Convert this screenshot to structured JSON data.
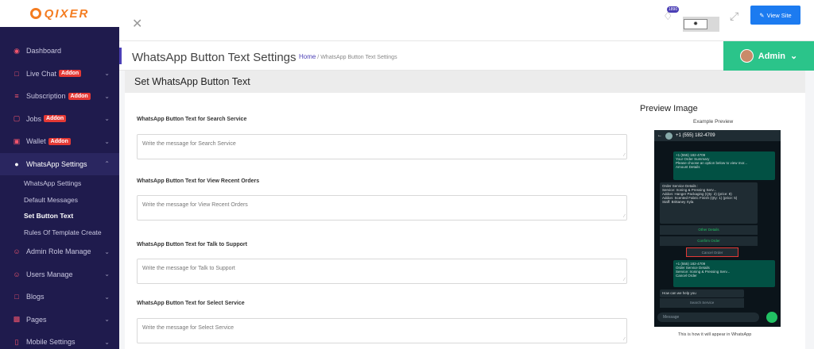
{
  "brand": {
    "name": "QIXER"
  },
  "sidebar": {
    "items": [
      {
        "label": "Dashboard",
        "icon": "palette-icon",
        "has_chevron": false
      },
      {
        "label": "Live Chat",
        "badge": "Addon",
        "icon": "chat-icon",
        "has_chevron": true
      },
      {
        "label": "Subscription",
        "badge": "Addon",
        "icon": "list-icon",
        "has_chevron": true
      },
      {
        "label": "Jobs",
        "badge": "Addon",
        "icon": "briefcase-icon",
        "has_chevron": true
      },
      {
        "label": "Wallet",
        "badge": "Addon",
        "icon": "wallet-icon",
        "has_chevron": true
      },
      {
        "label": "WhatsApp Settings",
        "icon": "whatsapp-icon",
        "has_chevron": true,
        "active": true
      }
    ],
    "sub_items": [
      {
        "label": "WhatsApp Settings"
      },
      {
        "label": "Default Messages"
      },
      {
        "label": "Set Button Text",
        "current": true
      },
      {
        "label": "Rules Of Template Create"
      }
    ],
    "items_after": [
      {
        "label": "Admin Role Manage",
        "icon": "user-icon"
      },
      {
        "label": "Users Manage",
        "icon": "user-icon"
      },
      {
        "label": "Blogs",
        "icon": "chat-icon"
      },
      {
        "label": "Pages",
        "icon": "pages-icon"
      },
      {
        "label": "Mobile Settings",
        "icon": "mobile-icon"
      }
    ]
  },
  "topbar": {
    "notification_count": "1890",
    "view_site_label": "View Site"
  },
  "header": {
    "title": "WhatsApp Button Text Settings",
    "breadcrumb_home": "Home",
    "breadcrumb_sep": "/",
    "breadcrumb_current": "WhatsApp Button Text Settings",
    "user_label": "Admin"
  },
  "section": {
    "title": "Set WhatsApp Button Text"
  },
  "form": {
    "fields": [
      {
        "label": "WhatsApp Button Text for Search Service",
        "placeholder": "Write the message for Search Service"
      },
      {
        "label": "WhatsApp Button Text for View Recent Orders",
        "placeholder": "Write the message for View Recent Orders"
      },
      {
        "label": "WhatsApp Button Text for Talk to Support",
        "placeholder": "Write the message for Talk to Support"
      },
      {
        "label": "WhatsApp Button Text for Select Service",
        "placeholder": "Write the message for Select Service"
      }
    ]
  },
  "preview": {
    "title": "Preview Image",
    "subtitle": "Example Preview",
    "caption": "This is how it will appear in WhatsApp",
    "phone": {
      "contact": "+1 (555) 182-4709",
      "msg1_line1": "+1 (555) 182-4709",
      "msg1_line2": "Your Order Summary",
      "msg1_line3": "Please choose an option below to view mor...",
      "msg1_line4": "Amount Details",
      "msg1_time": "3:40 pm",
      "details_title": "Order Service Details :",
      "details_line1": "Service: Ironing & Pressing Serv...",
      "details_line2": "Addon: Hanger Packaging (Qty: 2) (price: 8)",
      "details_line3": "Addon: Scented Fabric Finish (Qty: 1) (price: 5)",
      "details_line4": "Staff: Brittaney Xyla",
      "details_time": "3:40 pm",
      "btn_other": "Other Details",
      "btn_confirm": "Confirm Order",
      "btn_cancel": "Cancel Order",
      "msg2_line1": "+1 (555) 182-4709",
      "msg2_line2": "Order Service Details",
      "msg2_line3": "Service: Ironing & Pressing Serv...",
      "msg2_line4": "Cancel Order",
      "msg2_time": "3:41 pm",
      "msg3_text": "How can we help you",
      "msg3_time": "3:42 pm",
      "btn_search": "Search Service",
      "input_placeholder": "Message"
    }
  }
}
